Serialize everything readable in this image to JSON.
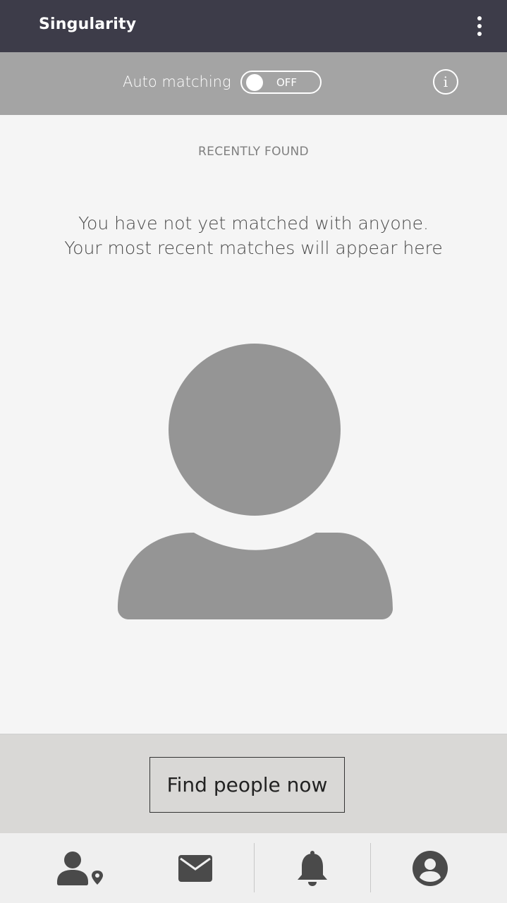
{
  "appbar": {
    "title": "Singularity",
    "menu_icon": "more-vert-icon"
  },
  "auto_matching": {
    "label": "Auto matching",
    "toggle_state": "OFF",
    "info_icon": "info-icon",
    "info_glyph": "i"
  },
  "main": {
    "section_heading": "RECENTLY FOUND",
    "empty_line_1": "You have not yet matched with anyone.",
    "empty_line_2": "Your most recent matches will appear here",
    "placeholder_icon": "person-placeholder-icon"
  },
  "cta": {
    "label": "Find people now"
  },
  "bottom_nav": {
    "items": [
      {
        "icon": "people-nearby-icon"
      },
      {
        "icon": "mail-icon"
      },
      {
        "icon": "bell-icon"
      },
      {
        "icon": "account-circle-icon"
      }
    ]
  },
  "colors": {
    "appbar": "#3d3c49",
    "autobar": "#a4a4a4",
    "placeholder": "#959595",
    "nav_icon": "#4a4a4a"
  }
}
